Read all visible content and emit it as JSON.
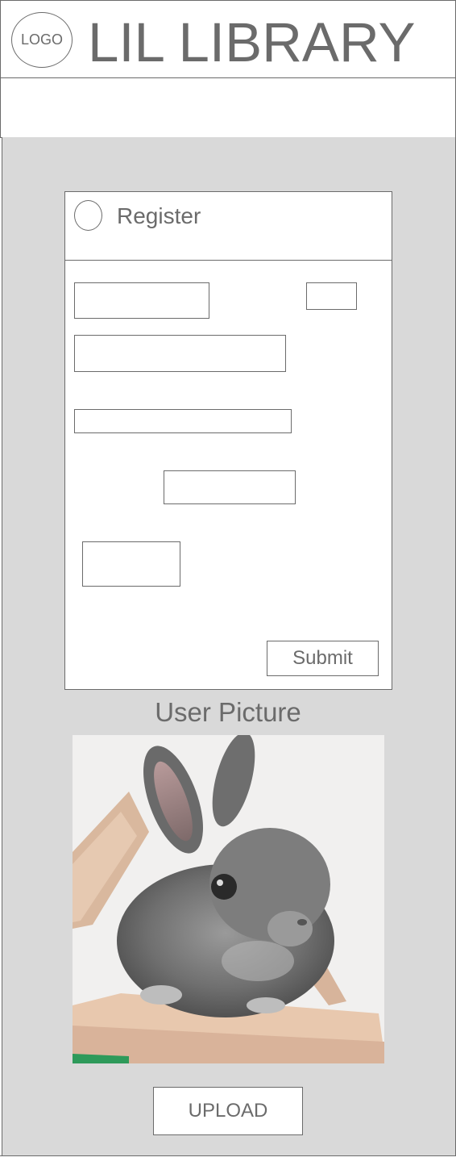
{
  "header": {
    "logo_text": "LOGO",
    "site_title": "LIL LIBRARY"
  },
  "register_form": {
    "title": "Register",
    "submit_label": "Submit"
  },
  "user_picture": {
    "label": "User Picture",
    "image_subject": "gray bunny on an open book",
    "upload_label": "UPLOAD"
  },
  "colors": {
    "border": "#6b6b6b",
    "main_background": "#d9d9d9",
    "text": "#6b6b6b"
  }
}
